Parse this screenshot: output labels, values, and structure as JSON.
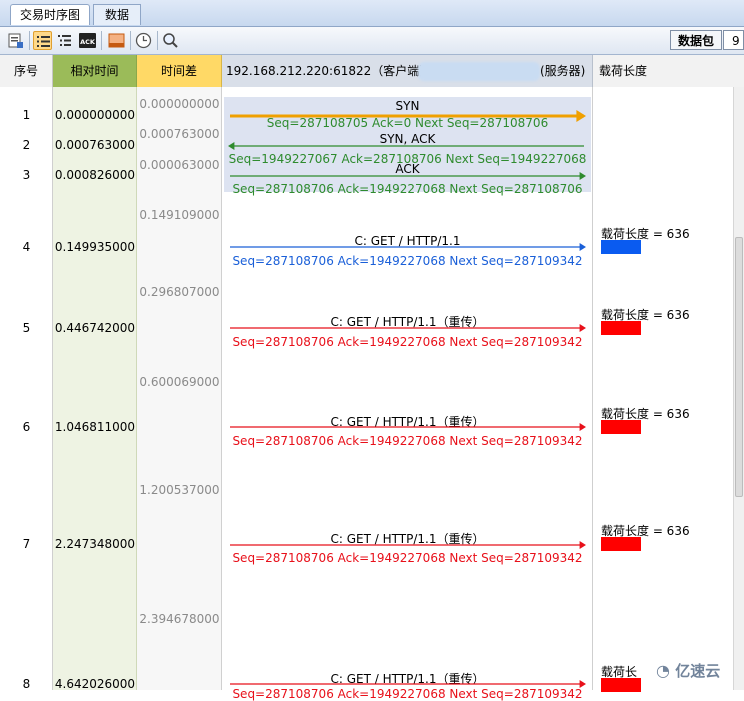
{
  "tabs": [
    {
      "label": "交易时序图"
    },
    {
      "label": "数据流"
    }
  ],
  "toolbar": {
    "icons": [
      "export-icon",
      "list-icon",
      "list-tree-icon",
      "ack-icon",
      "highlight-icon",
      "clock-icon",
      "search-icon"
    ],
    "packet_label": "数据包",
    "packet_value": "9"
  },
  "columns": {
    "seq": "序号",
    "rel_time": "相对时间",
    "delta": "时间差",
    "flow": "192.168.212.220:61822（客户端）",
    "server": "(服务器)",
    "payload": "载荷长度"
  },
  "rows": [
    {
      "seq": "1",
      "rel": "0.000000000",
      "delta": "0.000000000",
      "title": "SYN",
      "detail": "Seq=287108705  Ack=0  Next Seq=287108706",
      "dir": "right",
      "color": "#f0a000",
      "textcolor": "#2e8b2e"
    },
    {
      "seq": "2",
      "rel": "0.000763000",
      "delta": "0.000763000",
      "title": "SYN, ACK",
      "detail": "Seq=1949227067  Ack=287108706  Next Seq=1949227068",
      "dir": "left",
      "color": "#2e8b2e",
      "textcolor": "#2e8b2e"
    },
    {
      "seq": "3",
      "rel": "0.000826000",
      "delta": "0.000063000",
      "title": "ACK",
      "detail": "Seq=287108706  Ack=1949227068  Next Seq=287108706",
      "dir": "right",
      "color": "#2e8b2e",
      "textcolor": "#2e8b2e"
    },
    {
      "seq": "4",
      "rel": "0.149935000",
      "delta": "0.149109000",
      "title": "C: GET / HTTP/1.1",
      "detail": "Seq=287108706  Ack=1949227068  Next Seq=287109342",
      "dir": "right",
      "color": "#1a5fd8",
      "textcolor": "#1a5fd8",
      "payload": "载荷长度 = 636",
      "barcolor": "#0a5bf0"
    },
    {
      "seq": "5",
      "rel": "0.446742000",
      "delta": "0.296807000",
      "title": "C: GET / HTTP/1.1（重传）",
      "detail": "Seq=287108706  Ack=1949227068  Next Seq=287109342",
      "dir": "right",
      "color": "#e8101a",
      "textcolor": "#e8101a",
      "payload": "载荷长度 = 636",
      "barcolor": "#ff0000"
    },
    {
      "seq": "6",
      "rel": "1.046811000",
      "delta": "0.600069000",
      "title": "C: GET / HTTP/1.1（重传）",
      "detail": "Seq=287108706  Ack=1949227068  Next Seq=287109342",
      "dir": "right",
      "color": "#e8101a",
      "textcolor": "#e8101a",
      "payload": "载荷长度 = 636",
      "barcolor": "#ff0000"
    },
    {
      "seq": "7",
      "rel": "2.247348000",
      "delta": "1.200537000",
      "title": "C: GET / HTTP/1.1（重传）",
      "detail": "Seq=287108706  Ack=1949227068  Next Seq=287109342",
      "dir": "right",
      "color": "#e8101a",
      "textcolor": "#e8101a",
      "payload": "载荷长度 = 636",
      "barcolor": "#ff0000"
    },
    {
      "seq": "8",
      "rel": "4.642026000",
      "delta": "2.394678000",
      "title": "C: GET / HTTP/1.1（重传）",
      "detail": "Seq=287108706  Ack=1949227068  Next Seq=287109342",
      "dir": "right",
      "color": "#e8101a",
      "textcolor": "#e8101a",
      "payload": "载荷长",
      "barcolor": "#ff0000"
    }
  ],
  "watermark": "亿速云"
}
